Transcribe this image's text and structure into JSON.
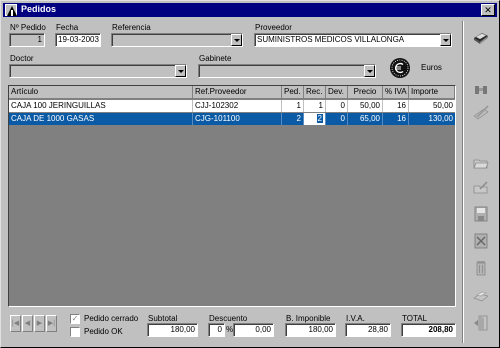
{
  "window": {
    "title": "Pedidos",
    "close_label": "✕"
  },
  "header": {
    "n_pedido_label": "Nº Pedido",
    "n_pedido": "1",
    "fecha_label": "Fecha",
    "fecha": "19-03-2003",
    "referencia_label": "Referencia",
    "referencia": "",
    "proveedor_label": "Proveedor",
    "proveedor": "SUMINISTROS MEDICOS VILLALONGA",
    "doctor_label": "Doctor",
    "doctor": "",
    "gabinete_label": "Gabinete",
    "gabinete": "",
    "currency_label": "Euros"
  },
  "table": {
    "columns": [
      "Artículo",
      "Ref.Proveedor",
      "Ped.",
      "Rec.",
      "Dev.",
      "Precio",
      "% IVA",
      "Importe"
    ],
    "rows": [
      [
        "CAJA 100 JERINGUILLAS",
        "CJJ-102302",
        "1",
        "1",
        "0",
        "50,00",
        "16",
        "50,00"
      ],
      [
        "CAJA DE 1000 GASAS",
        "CJG-101100",
        "2",
        "2",
        "0",
        "65,00",
        "16",
        "130,00"
      ]
    ],
    "selected_row": 1
  },
  "footer": {
    "pedido_cerrado_label": "Pedido cerrado",
    "pedido_cerrado_checked": true,
    "pedido_ok_label": "Pedido OK",
    "pedido_ok_checked": false,
    "subtotal_label": "Subtotal",
    "subtotal": "180,00",
    "descuento_label": "Descuento",
    "descuento_pct": "0",
    "descuento_pct_sign": "%",
    "descuento": "0,00",
    "base_label": "B. Imponible",
    "base": "180,00",
    "iva_label": "I.V.A.",
    "iva": "28,80",
    "total_label": "TOTAL",
    "total": "208,80"
  },
  "nav_glyphs": {
    "first": "|◀",
    "prev": "◀",
    "next": "▶",
    "last": "▶|"
  },
  "sidebar_icons": [
    "book-icon",
    "binoculars-icon",
    "edit-pencil-icon",
    "open-folder-icon",
    "folder-edit-icon",
    "save-disk-icon",
    "cancel-disk-icon",
    "trash-icon",
    "print-icon",
    "exit-door-icon"
  ],
  "colors": {
    "titlebar": "#000080",
    "selection": "#0a5aa5",
    "face": "#c0c0c0"
  }
}
